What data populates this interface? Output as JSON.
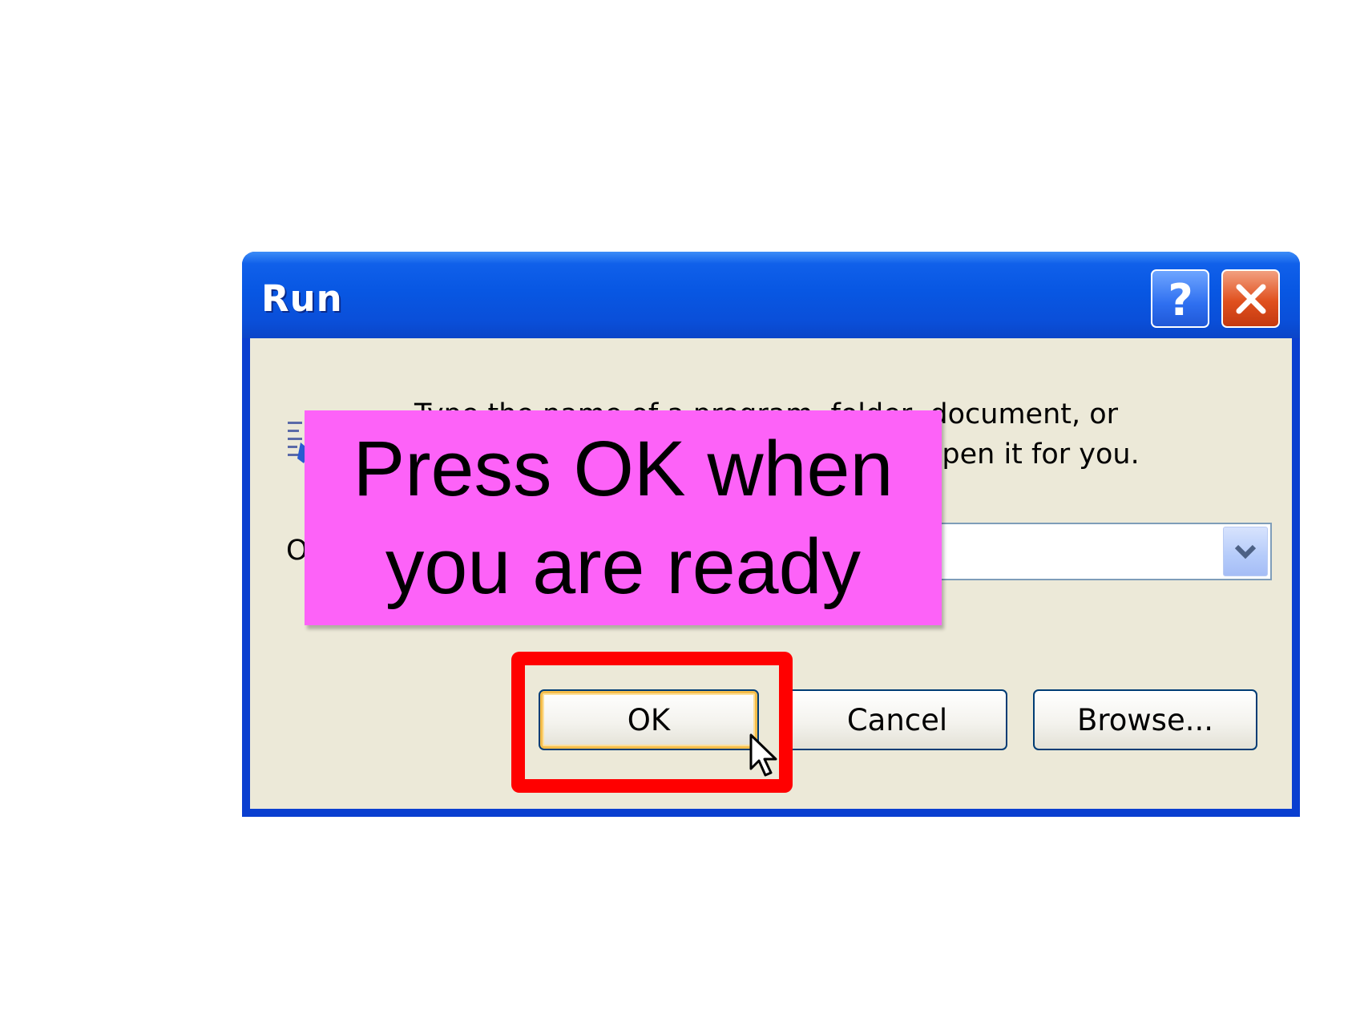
{
  "window": {
    "title": "Run",
    "help_label": "?",
    "close_label": "✕",
    "colors": {
      "titlebar": "#0857e3",
      "close": "#e0501e",
      "client": "#ece9d8"
    }
  },
  "dialog": {
    "description": "Type the name of a program, folder, document, or Internet resource, and Windows will open it for you.",
    "open_label": "Open:",
    "open_value": "",
    "dropdown_icon": "chevron-down-icon"
  },
  "buttons": {
    "ok": "OK",
    "cancel": "Cancel",
    "browse": "Browse..."
  },
  "callout": {
    "text": "Press OK when\nyou are ready",
    "color": "#fd62f8"
  },
  "highlight": {
    "color": "#ff0000",
    "target": "ok-button"
  },
  "icons": [
    "run-program-icon",
    "help-icon",
    "close-icon",
    "chevron-down-icon",
    "mouse-cursor-icon"
  ]
}
